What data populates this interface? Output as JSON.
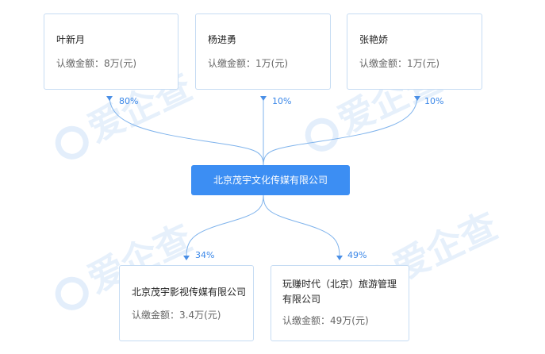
{
  "shareholders": [
    {
      "name": "叶新月",
      "amount": "认缴金额：8万(元)",
      "percent": "80%"
    },
    {
      "name": "杨进勇",
      "amount": "认缴金额：1万(元)",
      "percent": "10%"
    },
    {
      "name": "张艳娇",
      "amount": "认缴金额：1万(元)",
      "percent": "10%"
    }
  ],
  "company": {
    "name": "北京茂宇文化传媒有限公司"
  },
  "investments": [
    {
      "name": "北京茂宇影视传媒有限公司",
      "amount": "认缴金额：3.4万(元)",
      "percent": "34%"
    },
    {
      "name": "玩赚时代（北京）旅游管理有限公司",
      "amount": "认缴金额：49万(元)",
      "percent": "49%"
    }
  ],
  "watermark": {
    "text": "爱企查"
  },
  "colors": {
    "accent": "#3c8ef3",
    "line": "#7fb3ec",
    "border": "#c6dcf3",
    "watermark": "#e6f0fb"
  }
}
